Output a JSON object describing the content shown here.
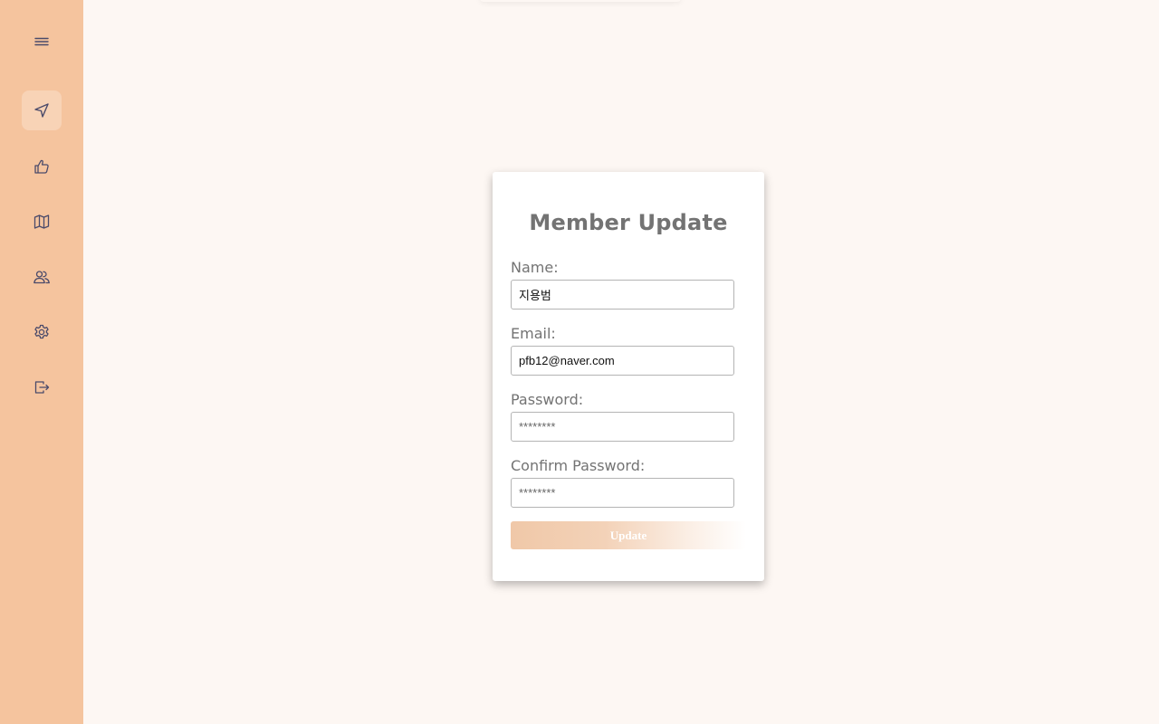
{
  "sidebar": {
    "items": [
      {
        "name": "menu",
        "icon": "menu-icon"
      },
      {
        "name": "navigate",
        "icon": "navigation-arrow-icon",
        "active": true
      },
      {
        "name": "recommend",
        "icon": "thumbs-up-icon"
      },
      {
        "name": "map",
        "icon": "map-icon"
      },
      {
        "name": "friends",
        "icon": "users-icon"
      },
      {
        "name": "settings",
        "icon": "gear-icon"
      },
      {
        "name": "logout",
        "icon": "logout-icon"
      }
    ],
    "background": "#f5c49e",
    "icon_color": "#4a4a6a"
  },
  "form": {
    "title": "Member Update",
    "name_label": "Name:",
    "name_value": "지용범",
    "email_label": "Email:",
    "email_value": "pfb12@naver.com",
    "password_label": "Password:",
    "password_placeholder": "********",
    "confirm_label": "Confirm Password:",
    "confirm_placeholder": "********",
    "submit_label": "Update"
  },
  "colors": {
    "page_background": "#fdf7f3",
    "accent": "#f0c8a8",
    "text": "#737373"
  }
}
